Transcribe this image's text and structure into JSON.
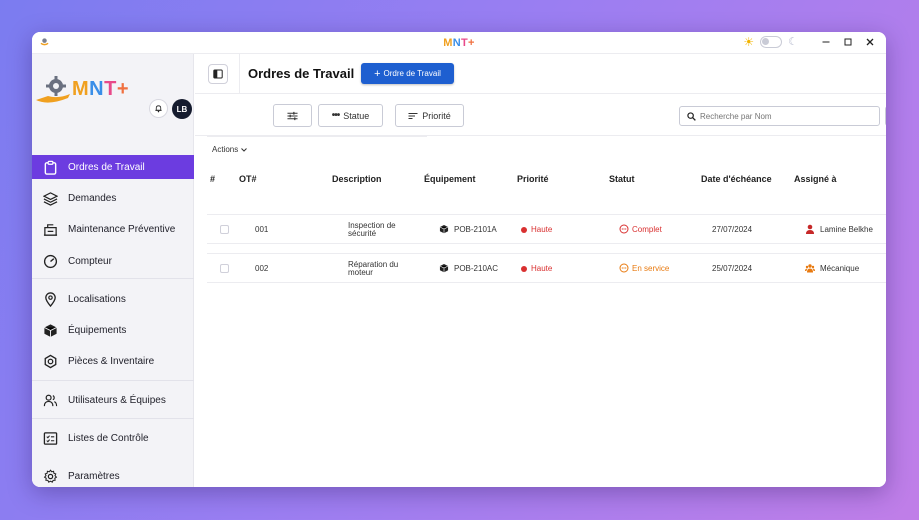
{
  "window": {
    "title_parts": [
      "M",
      "N",
      "T",
      "+"
    ]
  },
  "brand": {
    "logo_parts": [
      "M",
      "N",
      "T",
      "+"
    ],
    "colors": {
      "m": "#f0a020",
      "n": "#3a8ee8",
      "t": "#e84a8a",
      "plus": "#f07040",
      "accent": "#6c3ce0",
      "primary_button": "#1e5fd0"
    }
  },
  "user": {
    "initials": "LB"
  },
  "sidebar": {
    "items": [
      {
        "label": "Ordres de Travail",
        "icon": "clipboard-icon",
        "active": true
      },
      {
        "label": "Demandes",
        "icon": "layers-icon"
      },
      {
        "label": "Maintenance Préventive",
        "icon": "maintenance-icon"
      },
      {
        "label": "Compteur",
        "icon": "gauge-icon"
      },
      {
        "label": "Localisations",
        "icon": "location-pin-icon"
      },
      {
        "label": "Équipements",
        "icon": "cube-icon"
      },
      {
        "label": "Pièces & Inventaire",
        "icon": "parts-icon"
      },
      {
        "label": "Utilisateurs & Équipes",
        "icon": "users-icon"
      },
      {
        "label": "Listes de Contrôle",
        "icon": "checklist-icon"
      },
      {
        "label": "Paramètres",
        "icon": "gear-icon"
      }
    ]
  },
  "header": {
    "title": "Ordres de Travail",
    "add_button": "Ordre de Travail"
  },
  "filters": {
    "statue": "Statue",
    "priorite": "Priorité",
    "search_placeholder": "Recherche par Nom"
  },
  "table": {
    "actions_label": "Actions",
    "columns": [
      "#",
      "OT#",
      "Description",
      "Équipement",
      "Priorité",
      "Statut",
      "Date d'échéance",
      "Assigné à"
    ],
    "rows": [
      {
        "ot": "001",
        "description": "Inspection de sécurité",
        "equipment": "POB-2101A",
        "priority": "Haute",
        "status": "Complet",
        "status_color": "#d93030",
        "due": "27/07/2024",
        "assigned": "Lamine Belkhe",
        "assigned_icon": "person-icon"
      },
      {
        "ot": "002",
        "description": "Réparation du moteur",
        "equipment": "POB-210AC",
        "priority": "Haute",
        "status": "En service",
        "status_color": "#e87a10",
        "due": "25/07/2024",
        "assigned": "Mécanique",
        "assigned_icon": "team-icon"
      }
    ]
  }
}
